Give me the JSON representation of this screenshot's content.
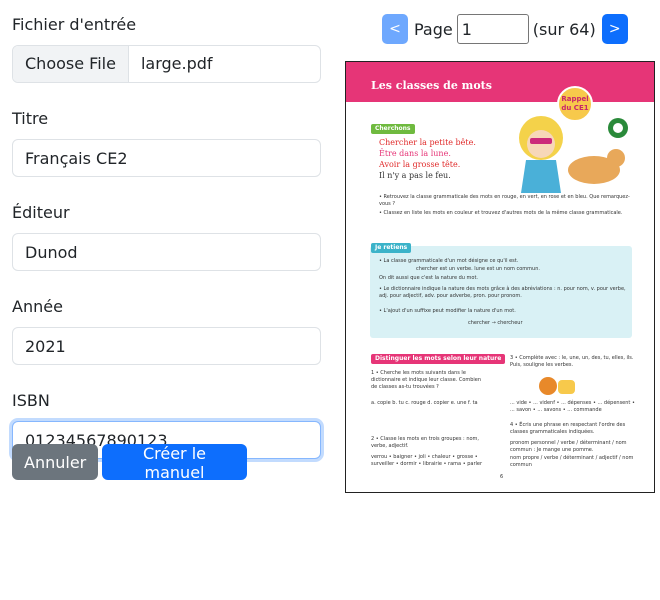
{
  "form": {
    "file_label": "Fichier d'entrée",
    "file_button": "Choose File",
    "file_name": "large.pdf",
    "title_label": "Titre",
    "title_value": "Français CE2",
    "publisher_label": "Éditeur",
    "publisher_value": "Dunod",
    "year_label": "Année",
    "year_value": "2021",
    "isbn_label": "ISBN",
    "isbn_value": "01234567890123"
  },
  "actions": {
    "cancel": "Annuler",
    "create": "Créer le manuel"
  },
  "pager": {
    "prev": "<",
    "page_label": "Page",
    "page_value": "1",
    "total": "(sur 64)",
    "next": ">"
  },
  "preview": {
    "title": "Les classes de mots",
    "badge": "Rappel du CE1",
    "tag_search": "Cherchons",
    "tag_retain": "Je retiens",
    "tag_exercise": "Distinguer les mots selon leur nature",
    "line1": "Chercher la petite bête.",
    "line2": "Être dans la lune.",
    "line3": "Avoir la grosse tête.",
    "line4": "Il n'y a pas le feu.",
    "q1": "• Retrouvez la classe grammaticale des mots en rouge, en vert, en rose et en bleu. Que remarquez-vous ?",
    "q2": "• Classez en liste les mots en couleur et trouvez d'autres mots de la même classe grammaticale.",
    "r1": "• La classe grammaticale d'un mot désigne ce qu'il est.",
    "r2": "chercher est un verbe. lune est un nom commun.",
    "r3": "On dit aussi que c'est la nature du mot.",
    "r4": "• Le dictionnaire indique la nature des mots grâce à des abréviations : n. pour nom, v. pour verbe, adj. pour adjectif, adv. pour adverbe, pron. pour pronom.",
    "r5": "• L'ajout d'un suffixe peut modifier la nature d'un mot.",
    "r6": "chercher → chercheur",
    "ex1": "1 • Cherche les mots suivants dans le dictionnaire et indique leur classe. Combien de classes as-tu trouvées ?",
    "ex1_items": "a. copie   b. tu   c. rouge   d. copier   e. une   f. ta",
    "ex2": "2 • Classe les mots en trois groupes : nom, verbe, adjectif.",
    "ex2_items": "verrou • baigner • joli • chaleur • grosse • surveiller • dormir • librairie • rama • parler",
    "ex3": "3 • Complète avec : le, une, un, des, tu, elles, ils. Puis, souligne les verbes.",
    "ex3_items": "... vide • ... videnf • ... dépenses • ... dépensent • ... savon • ... savons • ... commande",
    "ex4": "4 • Écris une phrase en respectant l'ordre des classes grammaticales indiquées.",
    "ex4_a": "pronom personnel / verbe / déterminant / nom commun : Je mange une pomme.",
    "ex4_b": "nom propre / verbe / déterminant / adjectif / nom commun",
    "page_number": "6"
  },
  "colors": {
    "primary": "#0d6efd",
    "secondary": "#6c757d",
    "pink": "#e63577",
    "green": "#6fba3f",
    "teal": "#3bb3c9"
  }
}
